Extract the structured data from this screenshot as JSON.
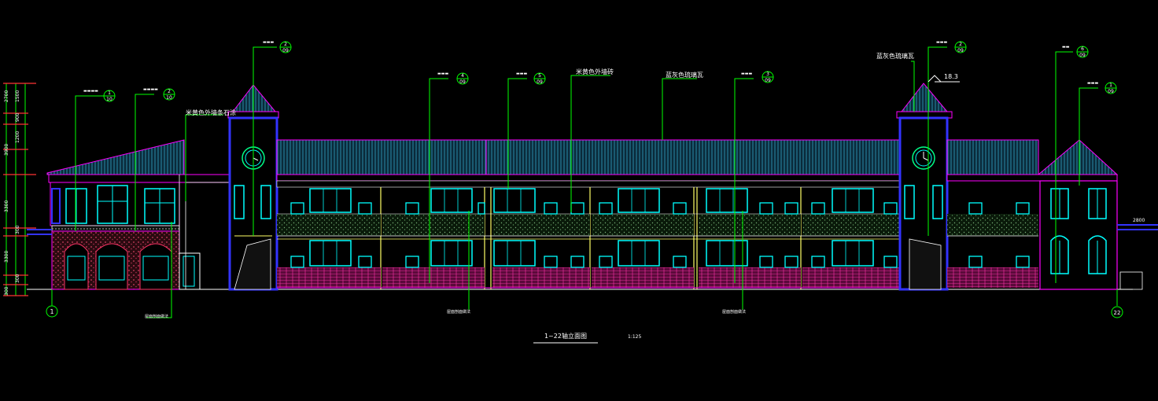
{
  "drawing": {
    "title": "1~22轴立面图",
    "scale": "1:125",
    "axis_left": "1",
    "axis_right": "22"
  },
  "colors": {
    "background": "#000000",
    "outline": "#ff00ff",
    "leader": "#00ff00",
    "window": "#00ffff",
    "tower": "#3333ff",
    "brick": "#ff00aa",
    "trim": "#ffff66",
    "text": "#ffffff"
  },
  "notes": {
    "facade_material": "米黄色外墙条石涂",
    "wall_tile": "米黄色外墙砖",
    "roof_tile": "蓝灰色琉璃瓦",
    "gable_tile": "蓝灰色琉璃瓦",
    "elevation_mark": "18.3",
    "right_dim": "2800",
    "detail_left": "屋面剖面做法",
    "detail_mid": "屋面剖面做法"
  },
  "callouts": [
    {
      "num": "1",
      "sheet": "10"
    },
    {
      "num": "2",
      "sheet": "10"
    },
    {
      "num": "2",
      "sheet": "09"
    },
    {
      "num": "4",
      "sheet": "09"
    },
    {
      "num": "5",
      "sheet": "09"
    },
    {
      "num": "3",
      "sheet": "09"
    },
    {
      "num": "2",
      "sheet": "09"
    },
    {
      "num": "6",
      "sheet": "09"
    },
    {
      "num": "1",
      "sheet": "09"
    }
  ],
  "left_dims": [
    "2700",
    "1500",
    "900",
    "1200",
    "3900",
    "3300",
    "300",
    "3300",
    "300",
    "300"
  ]
}
